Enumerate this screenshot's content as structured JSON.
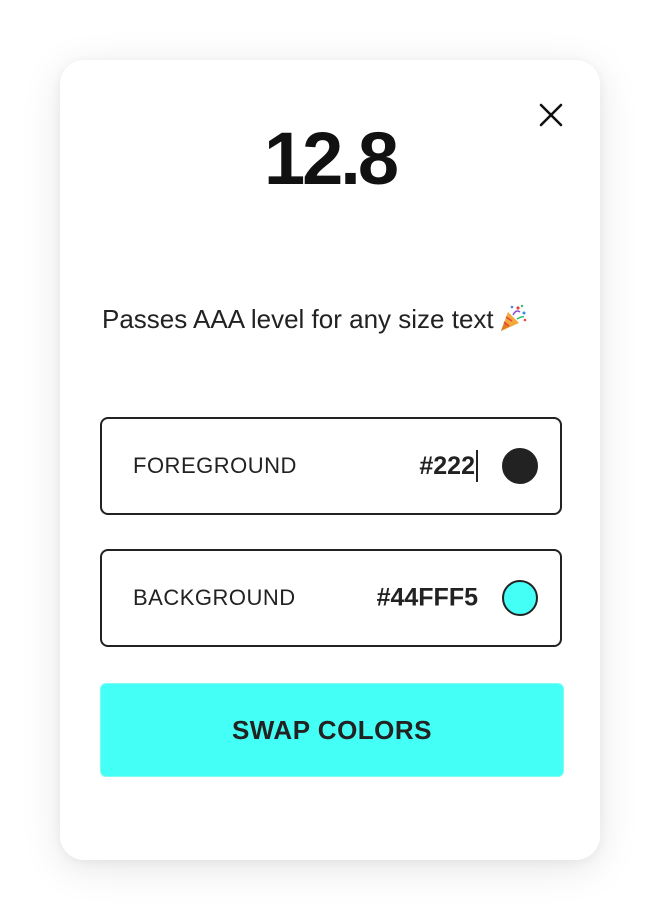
{
  "result": {
    "ratio": "12.8",
    "verdict": "Passes AAA level for any size text",
    "verdict_icon": "party-popper-icon"
  },
  "close": {
    "icon": "close-icon"
  },
  "foreground": {
    "label": "FOREGROUND",
    "value": "#222",
    "swatch_color": "#222222"
  },
  "background": {
    "label": "BACKGROUND",
    "value": "#44FFF5",
    "swatch_color": "#44FFF5"
  },
  "swap": {
    "label": "SWAP COLORS",
    "color": "#44FFF5"
  }
}
